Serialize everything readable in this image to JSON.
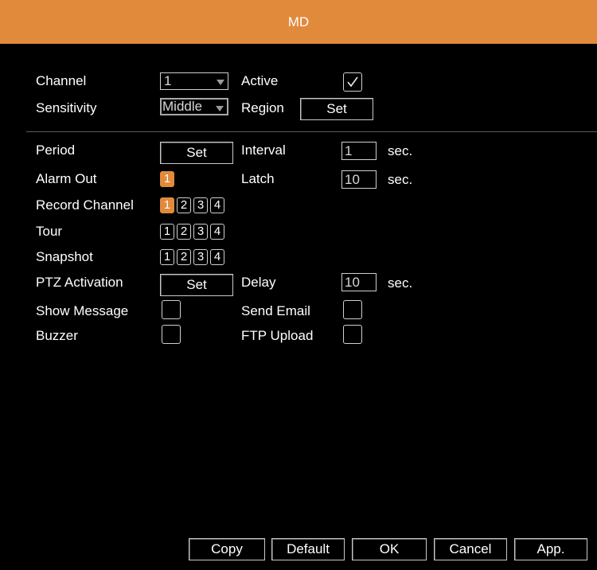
{
  "window": {
    "title": "MD"
  },
  "colors": {
    "accent": "#e28a3b",
    "background": "#000000",
    "text": "#ffffff"
  },
  "channel": {
    "label": "Channel",
    "value": "1"
  },
  "active": {
    "label": "Active",
    "checked": true
  },
  "sensitivity": {
    "label": "Sensitivity",
    "value": "Middle"
  },
  "region": {
    "label": "Region",
    "button": "Set"
  },
  "period": {
    "label": "Period",
    "button": "Set"
  },
  "interval": {
    "label": "Interval",
    "value": "1",
    "unit": "sec."
  },
  "alarm_out": {
    "label": "Alarm Out",
    "channels": [
      {
        "label": "1",
        "selected": true
      }
    ]
  },
  "latch": {
    "label": "Latch",
    "value": "10",
    "unit": "sec."
  },
  "record_channel": {
    "label": "Record Channel",
    "channels": [
      {
        "label": "1",
        "selected": true
      },
      {
        "label": "2",
        "selected": false
      },
      {
        "label": "3",
        "selected": false
      },
      {
        "label": "4",
        "selected": false
      }
    ]
  },
  "tour": {
    "label": "Tour",
    "channels": [
      {
        "label": "1",
        "selected": false
      },
      {
        "label": "2",
        "selected": false
      },
      {
        "label": "3",
        "selected": false
      },
      {
        "label": "4",
        "selected": false
      }
    ]
  },
  "snapshot": {
    "label": "Snapshot",
    "channels": [
      {
        "label": "1",
        "selected": false
      },
      {
        "label": "2",
        "selected": false
      },
      {
        "label": "3",
        "selected": false
      },
      {
        "label": "4",
        "selected": false
      }
    ]
  },
  "ptz_activation": {
    "label": "PTZ Activation",
    "button": "Set"
  },
  "delay": {
    "label": "Delay",
    "value": "10",
    "unit": "sec."
  },
  "show_message": {
    "label": "Show Message",
    "checked": false
  },
  "send_email": {
    "label": "Send Email",
    "checked": false
  },
  "buzzer": {
    "label": "Buzzer",
    "checked": false
  },
  "ftp_upload": {
    "label": "FTP Upload",
    "checked": false
  },
  "footer": {
    "copy": "Copy",
    "default": "Default",
    "ok": "OK",
    "cancel": "Cancel",
    "apply": "App."
  }
}
